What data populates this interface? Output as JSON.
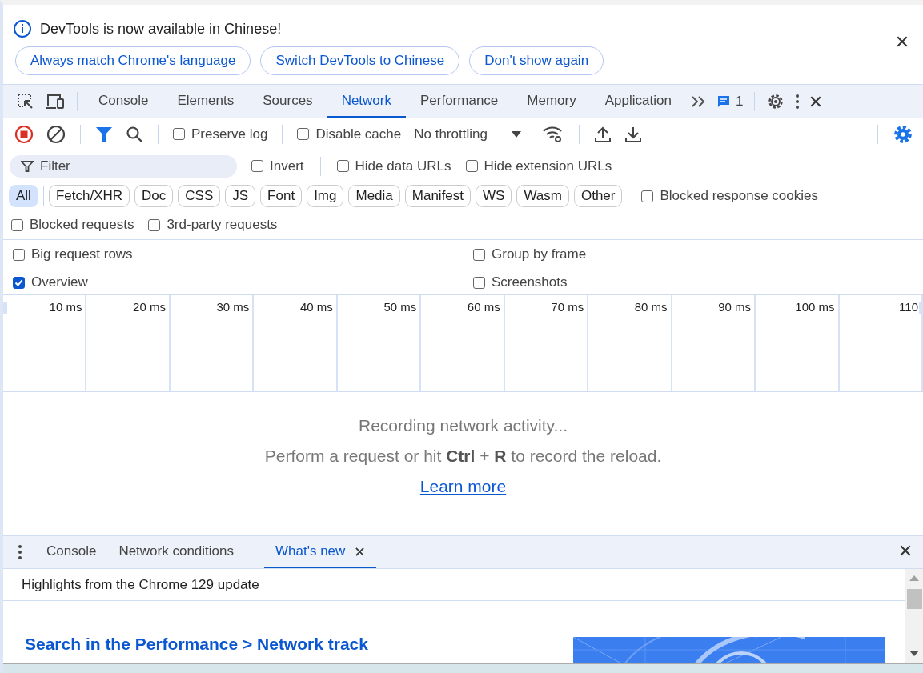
{
  "infobar": {
    "message": "DevTools is now available in Chinese!",
    "buttons": [
      "Always match Chrome's language",
      "Switch DevTools to Chinese",
      "Don't show again"
    ]
  },
  "main_tabs": [
    {
      "label": "Console",
      "selected": false
    },
    {
      "label": "Elements",
      "selected": false
    },
    {
      "label": "Sources",
      "selected": false
    },
    {
      "label": "Network",
      "selected": true
    },
    {
      "label": "Performance",
      "selected": false
    },
    {
      "label": "Memory",
      "selected": false
    },
    {
      "label": "Application",
      "selected": false
    }
  ],
  "issues_count": "1",
  "toolbar": {
    "preserve_log": {
      "label": "Preserve log",
      "checked": false
    },
    "disable_cache": {
      "label": "Disable cache",
      "checked": false
    },
    "throttling": "No throttling"
  },
  "filter": {
    "placeholder": "Filter",
    "options": [
      {
        "label": "Invert",
        "checked": false
      },
      {
        "label": "Hide data URLs",
        "checked": false
      },
      {
        "label": "Hide extension URLs",
        "checked": false
      }
    ]
  },
  "type_filters": [
    {
      "label": "All",
      "selected": true
    },
    {
      "label": "Fetch/XHR",
      "selected": false
    },
    {
      "label": "Doc",
      "selected": false
    },
    {
      "label": "CSS",
      "selected": false
    },
    {
      "label": "JS",
      "selected": false
    },
    {
      "label": "Font",
      "selected": false
    },
    {
      "label": "Img",
      "selected": false
    },
    {
      "label": "Media",
      "selected": false
    },
    {
      "label": "Manifest",
      "selected": false
    },
    {
      "label": "WS",
      "selected": false
    },
    {
      "label": "Wasm",
      "selected": false
    },
    {
      "label": "Other",
      "selected": false
    }
  ],
  "more_filters": [
    {
      "label": "Blocked response cookies",
      "checked": false
    },
    {
      "label": "Blocked requests",
      "checked": false
    },
    {
      "label": "3rd-party requests",
      "checked": false
    }
  ],
  "settings": [
    {
      "label": "Big request rows",
      "checked": false
    },
    {
      "label": "Group by frame",
      "checked": false
    },
    {
      "label": "Overview",
      "checked": true
    },
    {
      "label": "Screenshots",
      "checked": false
    }
  ],
  "timeline_ticks": [
    "10 ms",
    "20 ms",
    "30 ms",
    "40 ms",
    "50 ms",
    "60 ms",
    "70 ms",
    "80 ms",
    "90 ms",
    "100 ms",
    "110"
  ],
  "empty_state": {
    "title": "Recording network activity...",
    "hint": "Perform a request or hit **Ctrl** + **R** to record the reload.",
    "link": "Learn more"
  },
  "drawer_tabs": [
    {
      "label": "Console",
      "selected": false,
      "closable": false
    },
    {
      "label": "Network conditions",
      "selected": false,
      "closable": false
    },
    {
      "label": "What's new",
      "selected": true,
      "closable": true
    }
  ],
  "whats_new": {
    "header": "Highlights from the Chrome 129 update",
    "heading": "Search in the Performance > Network track"
  }
}
